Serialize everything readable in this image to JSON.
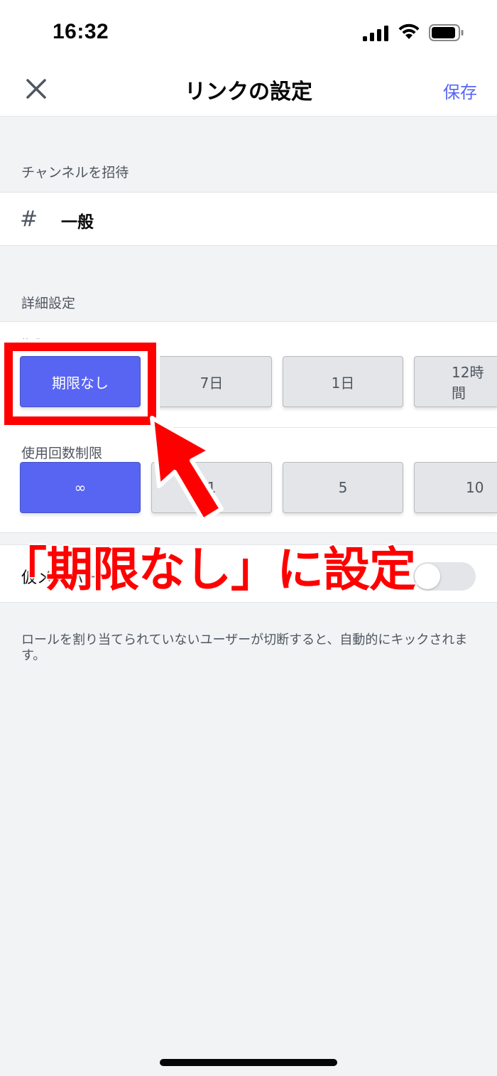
{
  "status": {
    "time": "16:32"
  },
  "nav": {
    "title": "リンクの設定",
    "save_label": "保存"
  },
  "invite_section": {
    "label": "チャンネルを招待",
    "channel_name": "一般"
  },
  "advanced_section": {
    "label": "詳細設定",
    "expire": {
      "label": "期限",
      "options": [
        "期限なし",
        "7日",
        "1日",
        "12時間"
      ],
      "selected": "期限なし"
    },
    "max_uses": {
      "label": "使用回数制限",
      "options": [
        "∞",
        "1",
        "5",
        "10"
      ],
      "selected": "∞"
    }
  },
  "temporary": {
    "label": "仮メンバー",
    "enabled": false,
    "help": "ロールを割り当てられていないユーザーが切断すると、自動的にキックされます。"
  },
  "annotation": {
    "text": "「期限なし」に設定",
    "color": "#ff0000"
  },
  "colors": {
    "accent": "#5865f2",
    "background": "#f2f3f5"
  }
}
